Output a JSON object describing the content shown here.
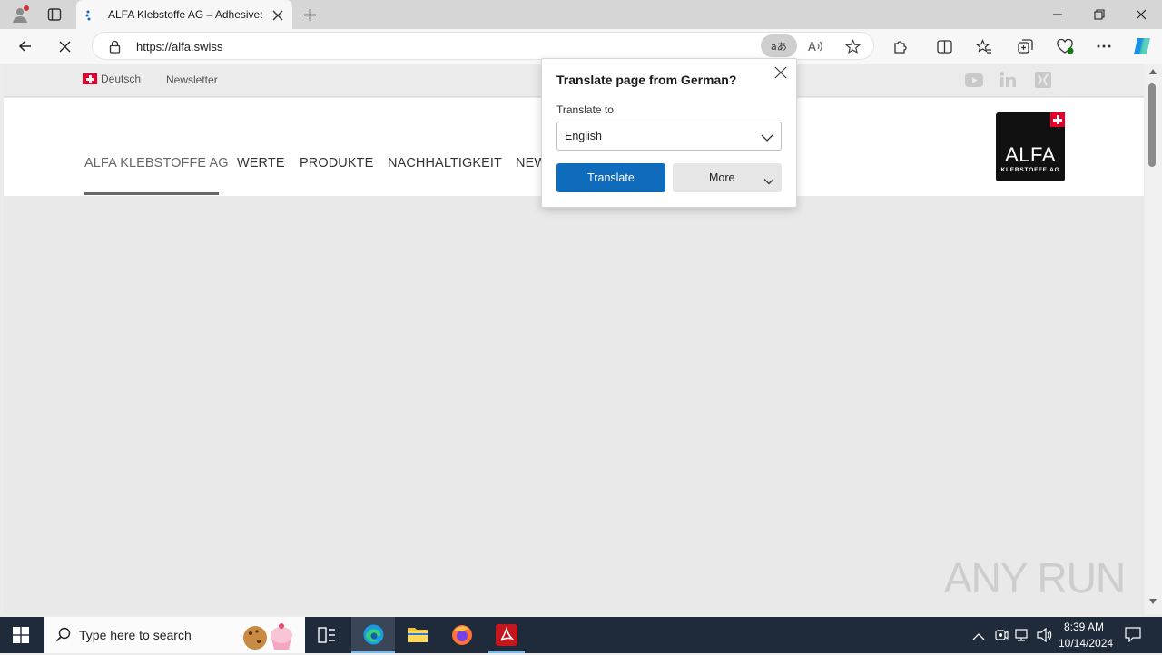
{
  "browser": {
    "tab_title": "ALFA Klebstoffe AG – Adhesives...",
    "url": "https://alfa.swiss"
  },
  "site": {
    "lang_label": "Deutsch",
    "newsletter_label": "Newsletter",
    "nav": [
      "ALFA KLEBSTOFFE AG",
      "WERTE",
      "PRODUKTE",
      "NACHHALTIGKEIT",
      "NEW"
    ],
    "logo_text": "ALFA",
    "logo_sub": "KLEBSTOFFE AG"
  },
  "translate_popup": {
    "title": "Translate page from German?",
    "translate_to_label": "Translate to",
    "selected_language": "English",
    "translate_button": "Translate",
    "more_button": "More"
  },
  "taskbar": {
    "search_placeholder": "Type here to search",
    "time": "8:39 AM",
    "date": "10/14/2024"
  },
  "watermark": "ANY RUN",
  "colors": {
    "accent": "#0f6cbd",
    "taskbar": "#1f2a3a",
    "swiss_red": "#e4002b"
  }
}
